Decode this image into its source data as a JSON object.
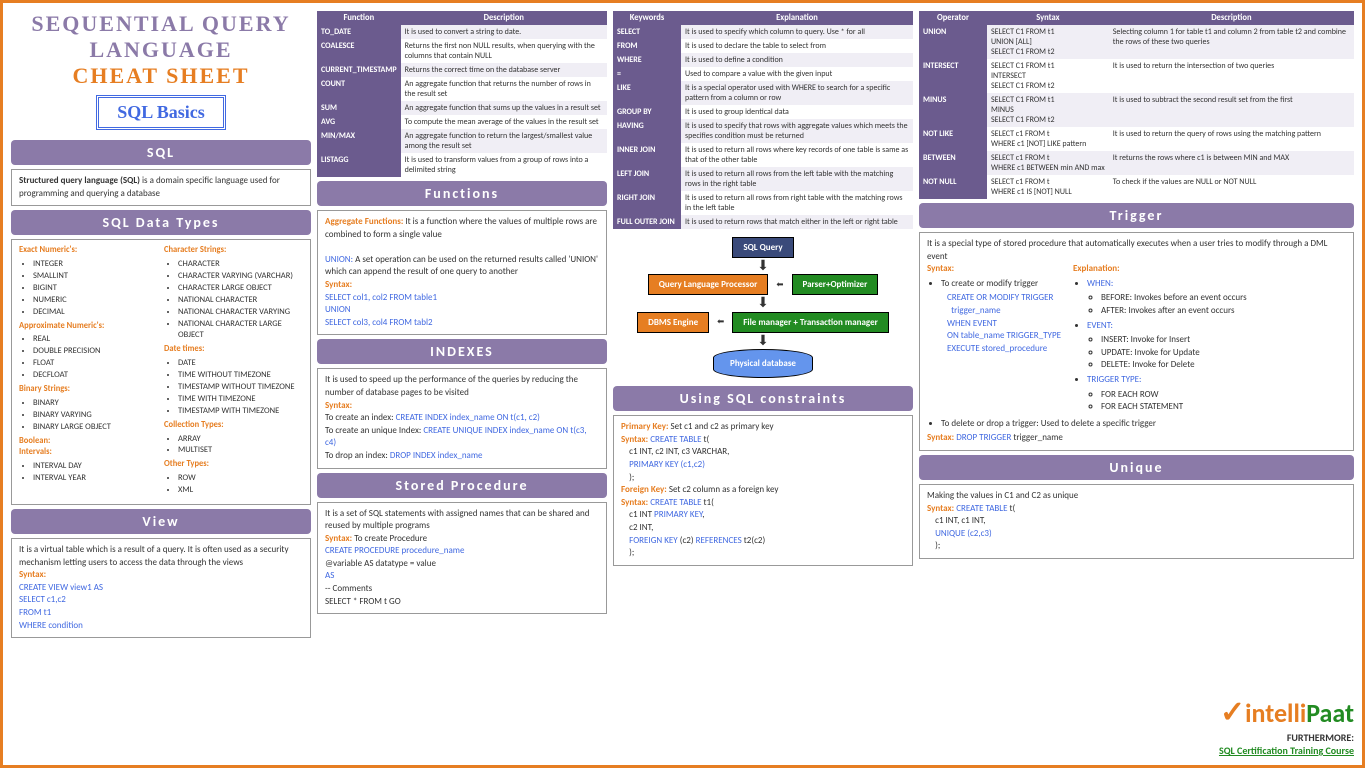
{
  "title": {
    "line1": "SEQUENTIAL QUERY",
    "line2": "LANGUAGE",
    "line3": "CHEAT SHEET",
    "badge": "SQL Basics"
  },
  "sql": {
    "head": "SQL",
    "body": "Structured query language (SQL) is a domain specific language used for programming and querying a database"
  },
  "datatypes": {
    "head": "SQL Data Types",
    "exact_h": "Exact Numeric's:",
    "exact": [
      "INTEGER",
      "SMALLINT",
      "BIGINT",
      "NUMERIC",
      "DECIMAL"
    ],
    "approx_h": "Approximate Numeric's:",
    "approx": [
      "REAL",
      "DOUBLE PRECISION",
      "FLOAT",
      "DECFLOAT"
    ],
    "binary_h": "Binary Strings:",
    "binary": [
      "BINARY",
      "BINARY VARYING",
      "BINARY LARGE OBJECT"
    ],
    "bool_h": "Boolean:",
    "interval_h": "Intervals:",
    "interval": [
      "INTERVAL DAY",
      "INTERVAL YEAR"
    ],
    "char_h": "Character Strings:",
    "char": [
      "CHARACTER",
      "CHARACTER VARYING (VARCHAR)",
      "CHARACTER LARGE OBJECT",
      "NATIONAL CHARACTER",
      "NATIONAL CHARACTER VARYING",
      "NATIONAL CHARACTER LARGE OBJECT"
    ],
    "dt_h": "Date times:",
    "dt": [
      "DATE",
      "TIME WITHOUT TIMEZONE",
      "TIMESTAMP WITHOUT TIMEZONE",
      "TIME WITH TIMEZONE",
      "TIMESTAMP WITH TIMEZONE"
    ],
    "coll_h": "Collection Types:",
    "coll": [
      "ARRAY",
      "MULTISET"
    ],
    "other_h": "Other Types:",
    "other": [
      "ROW",
      "XML"
    ]
  },
  "view": {
    "head": "View",
    "body": "It is a virtual table which is a result of a query. It is often used as a security mechanism letting users to access the data through the views",
    "syntax_lbl": "Syntax:",
    "s1": "CREATE VIEW view1 AS",
    "s2": "SELECT c1,c2",
    "s3": "FROM t1",
    "s4": "WHERE condition"
  },
  "functable": {
    "h1": "Function",
    "h2": "Description",
    "rows": [
      [
        "TO_DATE",
        "It is used to convert a string to date."
      ],
      [
        "COALESCE",
        "Returns the first non NULL results, when querying with the columns that contain NULL"
      ],
      [
        "CURRENT_TIMESTAMP",
        "Returns the correct time on the database server"
      ],
      [
        "COUNT",
        "An aggregate function that returns the number of rows in the result set"
      ],
      [
        "SUM",
        "An aggregate function that sums up the values in a result set"
      ],
      [
        "AVG",
        "To compute the mean average of the values in the result set"
      ],
      [
        "MIN/MAX",
        "An aggregate function to return the largest/smallest value among the result set"
      ],
      [
        "LISTAGG",
        "It is used to transform values from a group of rows into a delimited string"
      ]
    ]
  },
  "functions": {
    "head": "Functions",
    "agg_lbl": "Aggregate Functions:",
    "agg": "It is a function where the values of multiple rows are combined to form a single value",
    "union_lbl": "UNION:",
    "union": "A set operation can be used on the returned results called 'UNION' which can append the result of one query to another",
    "syntax_lbl": "Syntax:",
    "s1": "SELECT col1, col2 FROM table1",
    "s2": "UNION",
    "s3": "SELECT col3, col4 FROM tabl2"
  },
  "indexes": {
    "head": "INDEXES",
    "body": "It is used to speed up the performance of the queries by reducing the number of database pages to be visited",
    "syntax_lbl": "Syntax:",
    "l1a": "To create an index: ",
    "l1b": "CREATE INDEX index_name ON t(c1, c2)",
    "l2a": "To create an unique Index: ",
    "l2b": "CREATE UNIQUE INDEX index_name ON t(c3, c4)",
    "l3a": "To drop an index: ",
    "l3b": "DROP INDEX index_name"
  },
  "sp": {
    "head": "Stored Procedure",
    "body": "It is a set of SQL statements with assigned names that can be shared and reused by multiple programs",
    "syntax_lbl": "Syntax: To create Procedure",
    "s1": "CREATE PROCEDURE procedure_name",
    "s2": "@variable AS datatype = value",
    "s3": "AS",
    "s4": "-- Comments",
    "s5": "SELECT * FROM t GO"
  },
  "kwtable": {
    "h1": "Keywords",
    "h2": "Explanation",
    "rows": [
      [
        "SELECT",
        "It is used to specify which column to query. Use * for all"
      ],
      [
        "FROM",
        "It is used to declare the table to select from"
      ],
      [
        "WHERE",
        "It is used to define a condition"
      ],
      [
        "=",
        "Used to compare a value with the given input"
      ],
      [
        "LIKE",
        "It is a special operator used with WHERE to search for a specific pattern from a column or row"
      ],
      [
        "GROUP BY",
        "It is used to group identical data"
      ],
      [
        "HAVING",
        "It is used to specify that rows with aggregate values which meets the specifies condition must be returned"
      ],
      [
        "INNER JOIN",
        "It is used to return all rows where key records of one table is same as that of the other table"
      ],
      [
        "LEFT JOIN",
        "It is used to return all rows from the left table with the matching rows in the right table"
      ],
      [
        "RIGHT JOIN",
        "It is used to return all rows from right table with the matching rows in the left table"
      ],
      [
        "FULL OUTER JOIN",
        "It is used to return rows that match either in the left or right table"
      ]
    ]
  },
  "diagram": {
    "sq": "SQL Query",
    "qlp": "Query Language Processor",
    "po": "Parser+Optimizer",
    "dbms": "DBMS Engine",
    "fm": "File manager + Transaction manager",
    "pd": "Physical database"
  },
  "constraints": {
    "head": "Using SQL constraints",
    "pk_lbl": "Primary Key:",
    "pk": "Set c1 and c2 as primary key",
    "cs1": "Syntax: CREATE TABLE t(",
    "cs2": "    c1 INT, c2 INT, c3 VARCHAR,",
    "cs3": "    PRIMARY KEY (c1,c2)",
    "cs4": "    );",
    "fk_lbl": "Foreign Key:",
    "fk": "Set c2 column as a foreign key",
    "fs1": "Syntax: CREATE TABLE t1(",
    "fs2": "    c1 INT PRIMARY KEY,",
    "fs3": "    c2 INT,",
    "fs4": "    FOREIGN KEY (c2) REFERENCES t2(c2)",
    "fs5": "    );"
  },
  "optable": {
    "h1": "Operator",
    "h2": "Syntax",
    "h3": "Description",
    "rows": [
      [
        "UNION",
        "SELECT C1 FROM t1\nUNION [ALL]\nSELECT C1 FROM t2",
        "Selecting column 1 for table t1 and column 2 from table t2 and combine the rows of these two queries"
      ],
      [
        "INTERSECT",
        "SELECT C1 FROM t1\nINTERSECT\nSELECT C1 FROM t2",
        "It is used to return the intersection of two queries"
      ],
      [
        "MINUS",
        "SELECT C1 FROM t1\nMINUS\nSELECT C1 FROM t2",
        "It is used to subtract the second result set from the first"
      ],
      [
        "NOT LIKE",
        "SELECT c1 FROM t\nWHERE c1 [NOT] LIKE pattern",
        "It is used to return the query of rows using the matching pattern"
      ],
      [
        "BETWEEN",
        "SELECT c1 FROM t\nWHERE c1 BETWEEN min AND max",
        "It returns the rows where c1 is between MIN and MAX"
      ],
      [
        "NOT NULL",
        "SELECT c1 FROM t\nWHERE c1 IS [NOT] NULL",
        "To check if the values are NULL or NOT NULL"
      ]
    ]
  },
  "trigger": {
    "head": "Trigger",
    "body": "It is a special type of stored procedure that automatically executes when a user tries to modify through a DML event",
    "syntax_lbl": "Syntax:",
    "create": "To create or modify trigger",
    "s1": "CREATE OR MODIFY TRIGGER trigger_name",
    "s2": "WHEN EVENT",
    "s3": "ON table_name TRIGGER_TYPE",
    "s4": "EXECUTE stored_procedure",
    "exp_lbl": "Explanation:",
    "when_lbl": "WHEN:",
    "when": [
      "BEFORE: Invokes before an event occurs",
      "AFTER: Invokes after an event occurs"
    ],
    "event_lbl": "EVENT:",
    "event": [
      "INSERT: Invoke for Insert",
      "UPDATE: Invoke for Update",
      "DELETE: Invoke for Delete"
    ],
    "tt_lbl": "TRIGGER TYPE:",
    "tt": [
      "FOR EACH ROW",
      "FOR EACH STATEMENT"
    ],
    "del": "To delete or drop a trigger: Used to delete a specific trigger",
    "del_s": "Syntax: DROP TRIGGER trigger_name"
  },
  "unique": {
    "head": "Unique",
    "body": "Making the values in C1 and C2 as unique",
    "s1": "Syntax: CREATE TABLE t(",
    "s2": "    c1 INT, c1 INT,",
    "s3": "    UNIQUE (c2,c3)",
    "s4": "    );"
  },
  "footer": {
    "logo1": "intelli",
    "logo2": "Paat",
    "more": "FURTHERMORE:",
    "link": "SQL Certification Training Course"
  }
}
